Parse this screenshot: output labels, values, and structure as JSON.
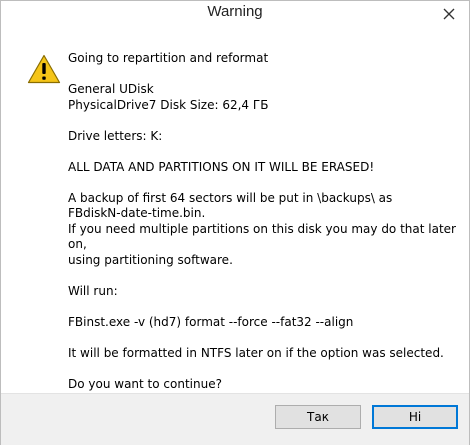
{
  "window": {
    "title": "Warning"
  },
  "message": {
    "line1": "Going to repartition and reformat",
    "disk_name": "General UDisk",
    "disk_info": "PhysicalDrive7   Disk Size: 62,4 ГБ",
    "drive_letters": "Drive letters:  K:",
    "erase_warning": "ALL DATA AND PARTITIONS ON IT WILL BE ERASED!",
    "backup_line1": "A backup of first 64 sectors will be put in \\backups\\ as",
    "backup_line2": "FBdiskN-date-time.bin.",
    "multi_line1": "If you need multiple partitions on this disk you may do that later on,",
    "multi_line2": "using partitioning software.",
    "will_run": "Will run:",
    "command": "FBinst.exe -v (hd7) format --force  --fat32 --align",
    "ntfs_note": "It will be formatted in NTFS later on if the option was selected.",
    "question": "Do you want to continue?"
  },
  "buttons": {
    "yes_label": "Так",
    "no_label": "Ні"
  },
  "icons": {
    "warning": "warning-triangle-icon",
    "close": "close-icon"
  },
  "colors": {
    "warning_yellow": "#f5c518",
    "button_face": "#e1e1e1",
    "focus_border": "#0078d7",
    "footer_bg": "#f0f0f0"
  }
}
